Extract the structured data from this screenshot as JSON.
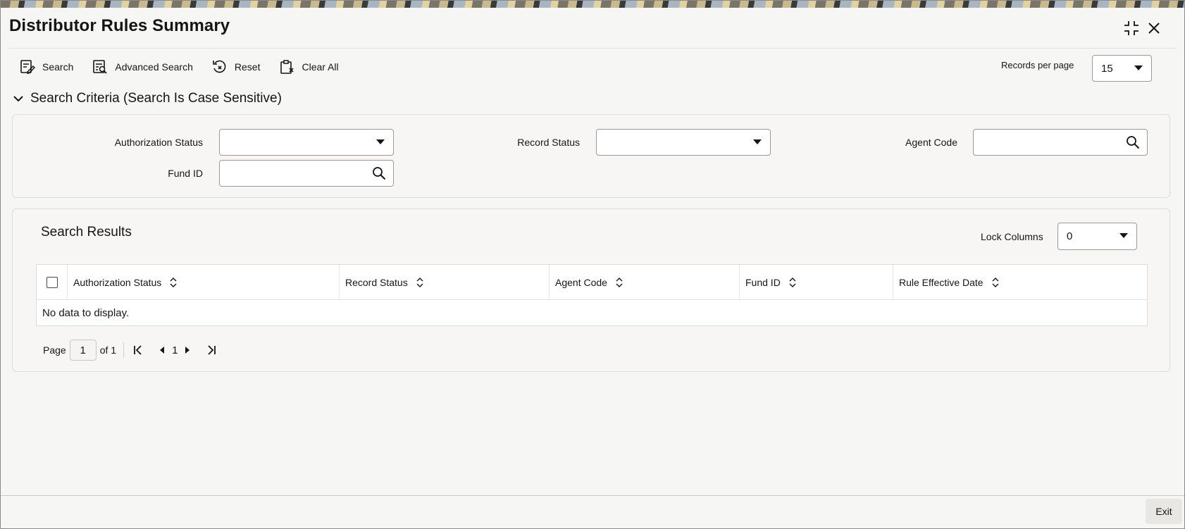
{
  "window": {
    "title": "Distributor Rules Summary"
  },
  "toolbar": {
    "search": "Search",
    "advanced_search": "Advanced Search",
    "reset": "Reset",
    "clear_all": "Clear All"
  },
  "records_per_page": {
    "label": "Records per page",
    "value": "15"
  },
  "criteria": {
    "heading": "Search Criteria (Search Is Case Sensitive)",
    "authorization_status": {
      "label": "Authorization Status",
      "value": ""
    },
    "record_status": {
      "label": "Record Status",
      "value": ""
    },
    "agent_code": {
      "label": "Agent Code",
      "value": ""
    },
    "fund_id": {
      "label": "Fund ID",
      "value": ""
    }
  },
  "results": {
    "heading": "Search Results",
    "lock_columns": {
      "label": "Lock Columns",
      "value": "0"
    },
    "columns": [
      "Authorization Status",
      "Record Status",
      "Agent Code",
      "Fund ID",
      "Rule Effective Date"
    ],
    "empty_message": "No data to display."
  },
  "pager": {
    "page_label": "Page",
    "current": "1",
    "of_label": "of 1",
    "page_number": "1"
  },
  "footer": {
    "exit": "Exit"
  }
}
